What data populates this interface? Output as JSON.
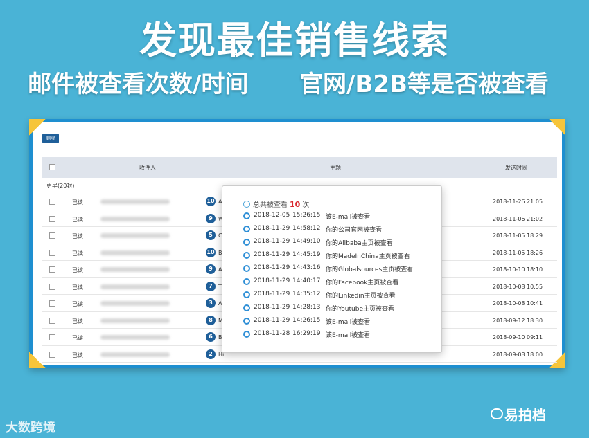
{
  "banner": {
    "title": "发现最佳销售线索",
    "subtitle_left": "邮件被查看次数/时间",
    "subtitle_right": "官网/B2B等是否被查看"
  },
  "toolbar": {
    "delete_label": "删除"
  },
  "table": {
    "headers": {
      "recipient": "收件人",
      "subject": "主题",
      "sent_time": "发送时间"
    },
    "group_label": "更早(20封)",
    "rows": [
      {
        "status": "已读",
        "count": "10",
        "subject_initial": "A",
        "sent": "2018-11-26 21:05"
      },
      {
        "status": "已读",
        "count": "9",
        "subject_initial": "W",
        "sent": "2018-11-06 21:02"
      },
      {
        "status": "已读",
        "count": "5",
        "subject_initial": "Co",
        "sent": "2018-11-05 18:29"
      },
      {
        "status": "已读",
        "count": "10",
        "subject_initial": "Be",
        "sent": "2018-11-05 18:26"
      },
      {
        "status": "已读",
        "count": "9",
        "subject_initial": "Ac",
        "sent": "2018-10-10 18:10"
      },
      {
        "status": "已读",
        "count": "7",
        "subject_initial": "Th",
        "sent": "2018-10-08 10:55"
      },
      {
        "status": "已读",
        "count": "3",
        "subject_initial": "Al",
        "sent": "2018-10-08 10:41"
      },
      {
        "status": "已读",
        "count": "8",
        "subject_initial": "M",
        "sent": "2018-09-12 18:30"
      },
      {
        "status": "已读",
        "count": "6",
        "subject_initial": "BT",
        "sent": "2018-09-10 09:11"
      },
      {
        "status": "已读",
        "count": "2",
        "subject_initial": "Hi",
        "sent": "2018-09-08 18:00"
      }
    ]
  },
  "popup": {
    "total_prefix": "总共被查看",
    "total_count": "10",
    "total_suffix": "次",
    "events": [
      {
        "date": "2018-12-05",
        "time": "15:26:15",
        "desc": "该E-mail被查看"
      },
      {
        "date": "2018-11-29",
        "time": "14:58:12",
        "desc": "你的公司官网被查看"
      },
      {
        "date": "2018-11-29",
        "time": "14:49:10",
        "desc": "你的Alibaba主页被查看"
      },
      {
        "date": "2018-11-29",
        "time": "14:45:19",
        "desc": "你的MadeInChina主页被查看"
      },
      {
        "date": "2018-11-29",
        "time": "14:43:16",
        "desc": "你的Globalsources主页被查看"
      },
      {
        "date": "2018-11-29",
        "time": "14:40:17",
        "desc": "你的Facebook主页被查看"
      },
      {
        "date": "2018-11-29",
        "time": "14:35:12",
        "desc": "你的Linkedin主页被查看"
      },
      {
        "date": "2018-11-29",
        "time": "14:28:13",
        "desc": "你的Youtube主页被查看"
      },
      {
        "date": "2018-11-29",
        "time": "14:26:15",
        "desc": "该E-mail被查看"
      },
      {
        "date": "2018-11-28",
        "time": "16:29:19",
        "desc": "该E-mail被查看"
      }
    ]
  },
  "footer": {
    "left_logo": "大数跨境",
    "right_logo": "易拍档"
  },
  "colors": {
    "background": "#4ab3d6",
    "frame": "#1e8fd0",
    "badge": "#1f5f99",
    "highlight": "#d9272e"
  }
}
